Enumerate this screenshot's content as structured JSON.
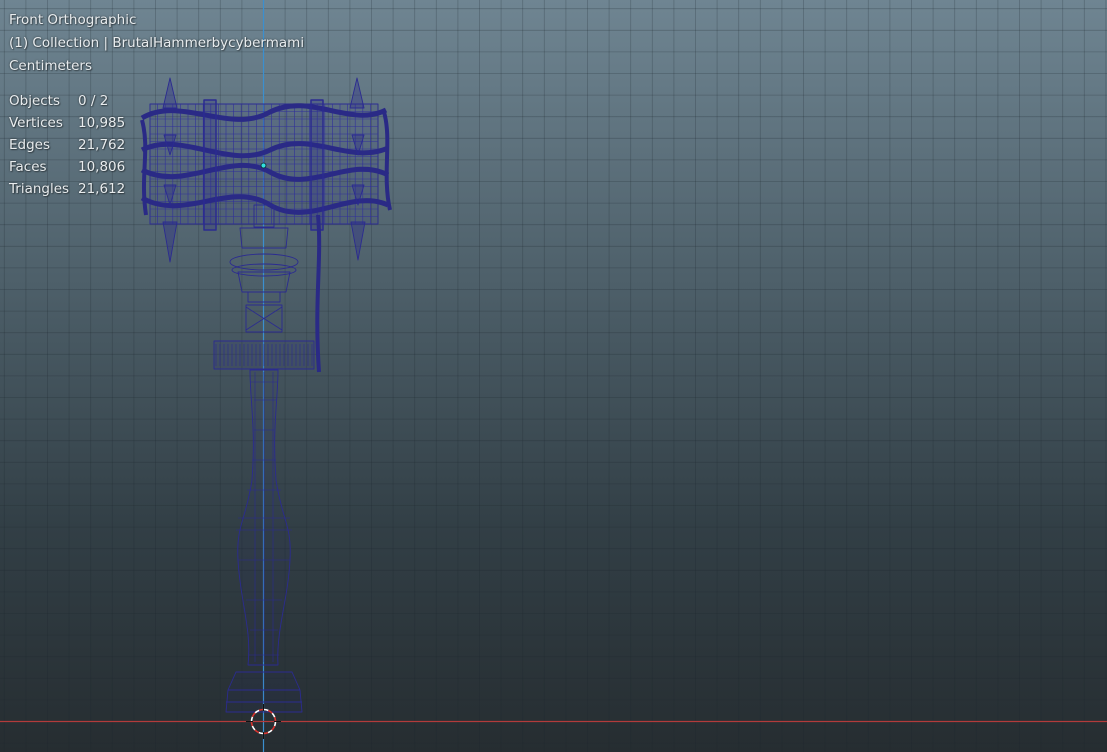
{
  "viewport": {
    "view_name": "Front Orthographic",
    "collection": "(1) Collection | BrutalHammerbycybermami",
    "units": "Centimeters",
    "background_top": "#6f8592",
    "background_bottom": "#262d31",
    "wire_color": "#2a2a8e"
  },
  "stats": [
    {
      "label": "Objects",
      "value": "0 / 2"
    },
    {
      "label": "Vertices",
      "value": "10,985"
    },
    {
      "label": "Edges",
      "value": "21,762"
    },
    {
      "label": "Faces",
      "value": "10,806"
    },
    {
      "label": "Triangles",
      "value": "21,612"
    }
  ],
  "icons": {
    "origin": "object-origin-icon",
    "cursor": "3d-cursor-icon"
  }
}
